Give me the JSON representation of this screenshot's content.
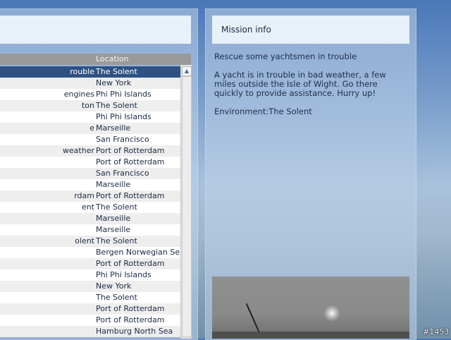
{
  "table": {
    "location_header": "Location",
    "rows": [
      {
        "mission": "rouble",
        "location": "The Solent",
        "selected": true
      },
      {
        "mission": "",
        "location": "New York"
      },
      {
        "mission": "engines",
        "location": "Phi Phi Islands"
      },
      {
        "mission": "ton",
        "location": "The Solent"
      },
      {
        "mission": "",
        "location": "Phi Phi Islands"
      },
      {
        "mission": "e",
        "location": "Marseille"
      },
      {
        "mission": "",
        "location": "San Francisco"
      },
      {
        "mission": "weather",
        "location": "Port of Rotterdam"
      },
      {
        "mission": "",
        "location": "Port of Rotterdam"
      },
      {
        "mission": "",
        "location": "San Francisco"
      },
      {
        "mission": "",
        "location": "Marseille"
      },
      {
        "mission": "rdam",
        "location": "Port of Rotterdam"
      },
      {
        "mission": "ent",
        "location": "The Solent"
      },
      {
        "mission": "",
        "location": "Marseille"
      },
      {
        "mission": "",
        "location": "Marseille"
      },
      {
        "mission": "olent",
        "location": "The Solent"
      },
      {
        "mission": "",
        "location": "Bergen Norwegian Se"
      },
      {
        "mission": "",
        "location": "Port of Rotterdam"
      },
      {
        "mission": "",
        "location": "Phi Phi Islands"
      },
      {
        "mission": "",
        "location": "New York"
      },
      {
        "mission": "",
        "location": "The Solent"
      },
      {
        "mission": "",
        "location": "Port of Rotterdam"
      },
      {
        "mission": "",
        "location": "Port of Rotterdam"
      },
      {
        "mission": "",
        "location": "Hamburg North Sea"
      }
    ]
  },
  "mission_info": {
    "title": "Mission info",
    "name": "Rescue some yachtsmen in trouble",
    "description": "A yacht is in trouble in bad weather, a few miles outside the Isle of Wight. Go there quickly to provide assistance. Hurry up!",
    "environment": "Environment:The Solent"
  },
  "overlay": {
    "image_id": "#1453"
  },
  "icons": {
    "scroll_up": "triangle-up-icon"
  }
}
